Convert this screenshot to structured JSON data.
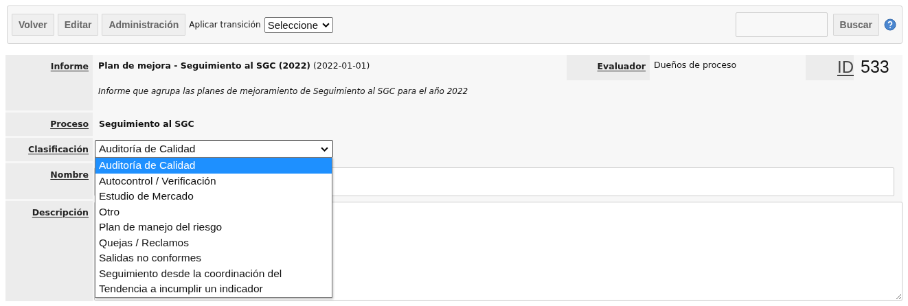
{
  "toolbar": {
    "buttons": [
      "Volver",
      "Editar",
      "Administración"
    ],
    "transition_label": "Aplicar transición",
    "transition_select": {
      "value": "Seleccione"
    },
    "search_button": "Buscar"
  },
  "informe": {
    "label": "Informe",
    "title": "**Plan de mejora - Seguimiento al SGC (2022)** (2022-01-01)",
    "description": "Informe que agrupa las planes de mejoramiento de Seguimiento al SGC para el año 2022"
  },
  "evaluador": {
    "label": "Evaluador",
    "value": "Dueños de proceso"
  },
  "id": {
    "label": "ID",
    "value": "533"
  },
  "proceso": {
    "label": "Proceso",
    "value": "Seguimiento al SGC"
  },
  "clasificacion": {
    "label": "Clasificación",
    "value": "Auditoría de Calidad",
    "expanded": true,
    "options": [
      {
        "label": "Auditoría de Calidad",
        "selected": true
      },
      {
        "label": "Autocontrol / Verificación",
        "selected": false
      },
      {
        "label": "Estudio de Mercado",
        "selected": false
      },
      {
        "label": "Otro",
        "selected": false
      },
      {
        "label": "Plan de manejo del riesgo",
        "selected": false
      },
      {
        "label": "Quejas / Reclamos",
        "selected": false
      },
      {
        "label": "Salidas no conformes",
        "selected": false
      },
      {
        "label": "Seguimiento desde la coordinación del",
        "selected": false
      },
      {
        "label": "Tendencia a incumplir un indicador",
        "selected": false
      }
    ]
  },
  "nombre": {
    "label": "Nombre"
  },
  "descripcion": {
    "label": "Descripción"
  }
}
